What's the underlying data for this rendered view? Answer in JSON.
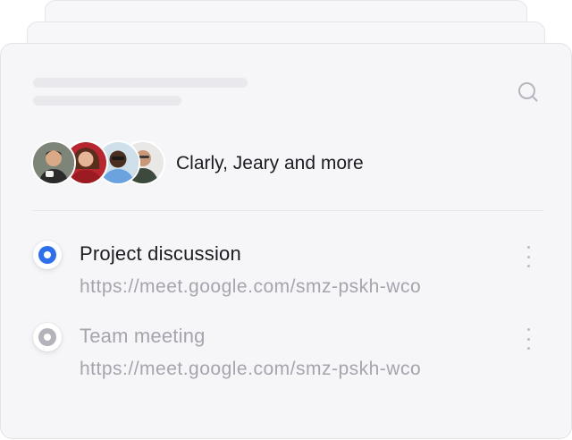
{
  "participants": {
    "label": "Clarly, Jeary and more",
    "avatars": [
      {
        "name": "avatar-1"
      },
      {
        "name": "avatar-2"
      },
      {
        "name": "avatar-3"
      },
      {
        "name": "avatar-4"
      }
    ]
  },
  "meetings": [
    {
      "title": "Project discussion",
      "url": "https://meet.google.com/smz-pskh-wco",
      "selected": true
    },
    {
      "title": "Team meeting",
      "url": "https://meet.google.com/smz-pskh-wco",
      "selected": false
    }
  ],
  "icons": {
    "search": "search-icon",
    "more": "more-vertical-icon"
  },
  "colors": {
    "accent": "#2f6fed",
    "inactive_radio": "#b4b2ba",
    "title_active": "#1d1c22",
    "title_inactive": "#a6a4ad",
    "url": "#a6a4ad"
  }
}
